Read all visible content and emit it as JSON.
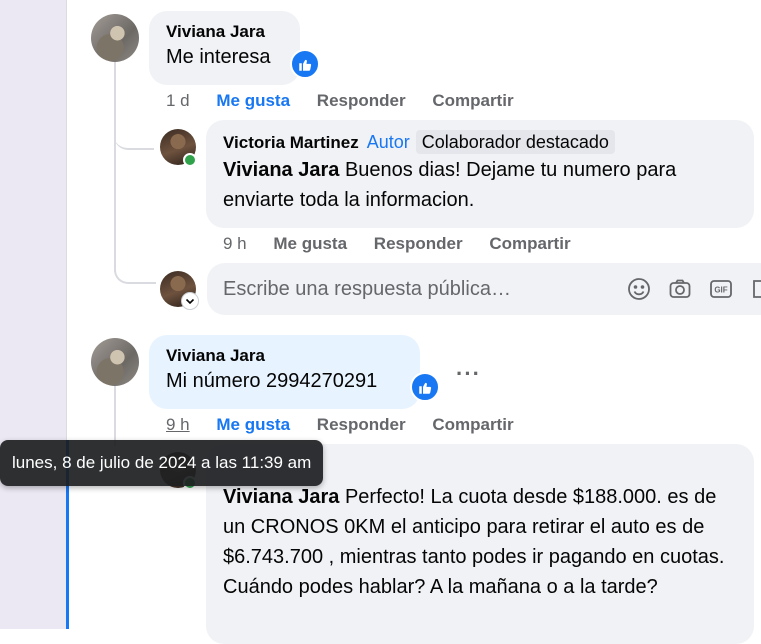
{
  "thread": {
    "comment1": {
      "author": "Viviana Jara",
      "text": "Me interesa",
      "time": "1 d",
      "like": "Me gusta",
      "reply": "Responder",
      "share": "Compartir"
    },
    "reply1": {
      "author": "Victoria Martinez",
      "author_badge": "Autor",
      "contributor_badge": "Colaborador destacado",
      "mention": "Viviana Jara",
      "text": "Buenos dias! Dejame tu numero para enviarte toda la informacion.",
      "time": "9 h",
      "like": "Me gusta",
      "reply": "Responder",
      "share": "Compartir"
    },
    "reply_input": {
      "placeholder": "Escribe una respuesta pública…"
    },
    "comment2": {
      "author": "Viviana Jara",
      "text": "Mi número 2994270291",
      "time": "9 h",
      "like": "Me gusta",
      "reply": "Responder",
      "share": "Compartir",
      "more": "···"
    },
    "reply2": {
      "mention": "Viviana Jara",
      "text": "Perfecto! La cuota desde $188.000. es de un CRONOS 0KM el anticipo para retirar el auto es de $6.743.700 , mientras tanto podes ir pagando en cuotas. Cuándo podes hablar? A la mañana o a la tarde?"
    },
    "tooltip": "lunes, 8 de julio de 2024 a las 11:39 am"
  },
  "colors": {
    "accent": "#1877f2",
    "bubble_gray": "#f0f2f5",
    "bubble_highlight": "#e7f3ff",
    "online": "#31a24c"
  },
  "icons": [
    "like-icon",
    "emoji-icon",
    "camera-icon",
    "gif-icon",
    "sticker-icon",
    "chevron-down-icon",
    "more-icon"
  ]
}
